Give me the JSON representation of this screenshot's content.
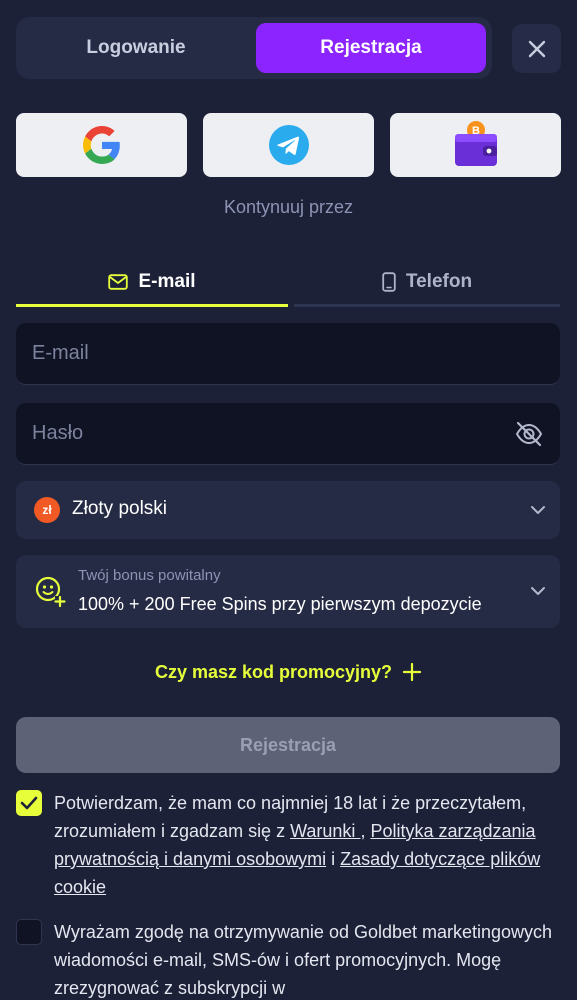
{
  "auth_tabs": {
    "login": "Logowanie",
    "register": "Rejestracja"
  },
  "social": {
    "continue_label": "Kontynuuj przez",
    "icons": [
      "google-icon",
      "telegram-icon",
      "crypto-wallet-icon"
    ]
  },
  "method_tabs": {
    "email": "E-mail",
    "phone": "Telefon",
    "active": "email"
  },
  "form": {
    "email_placeholder": "E-mail",
    "password_placeholder": "Hasło",
    "currency_badge": "zł",
    "currency": "Złoty polski",
    "bonus_label": "Twój bonus powitalny",
    "bonus_value": "100% + 200 Free Spins przy pierwszym depozycie",
    "promo_link": "Czy masz kod promocyjny?",
    "submit": "Rejestracja"
  },
  "consents": {
    "age": {
      "checked": true,
      "text_before": "Potwierdzam, że mam co najmniej 18 lat i że przeczytałem, zrozumiałem i zgadzam się z ",
      "link_terms": "Warunki ",
      "sep": ", ",
      "link_privacy": "Polityka zarządzania prywatnością i danymi osobowymi",
      "sep2": " i ",
      "link_cookies": "Zasady dotyczące plików cookie"
    },
    "marketing": {
      "checked": false,
      "text": "Wyrażam zgodę na otrzymywanie od Goldbet marketingowych wiadomości e-mail, SMS-ów i ofert promocyjnych. Mogę zrezygnować z subskrypcji w"
    }
  },
  "colors": {
    "background": "#1c2138",
    "accent_purple": "#8c24ff",
    "accent_yellow": "#e6ff3a",
    "panel": "#252b45",
    "input": "#0f1324"
  }
}
